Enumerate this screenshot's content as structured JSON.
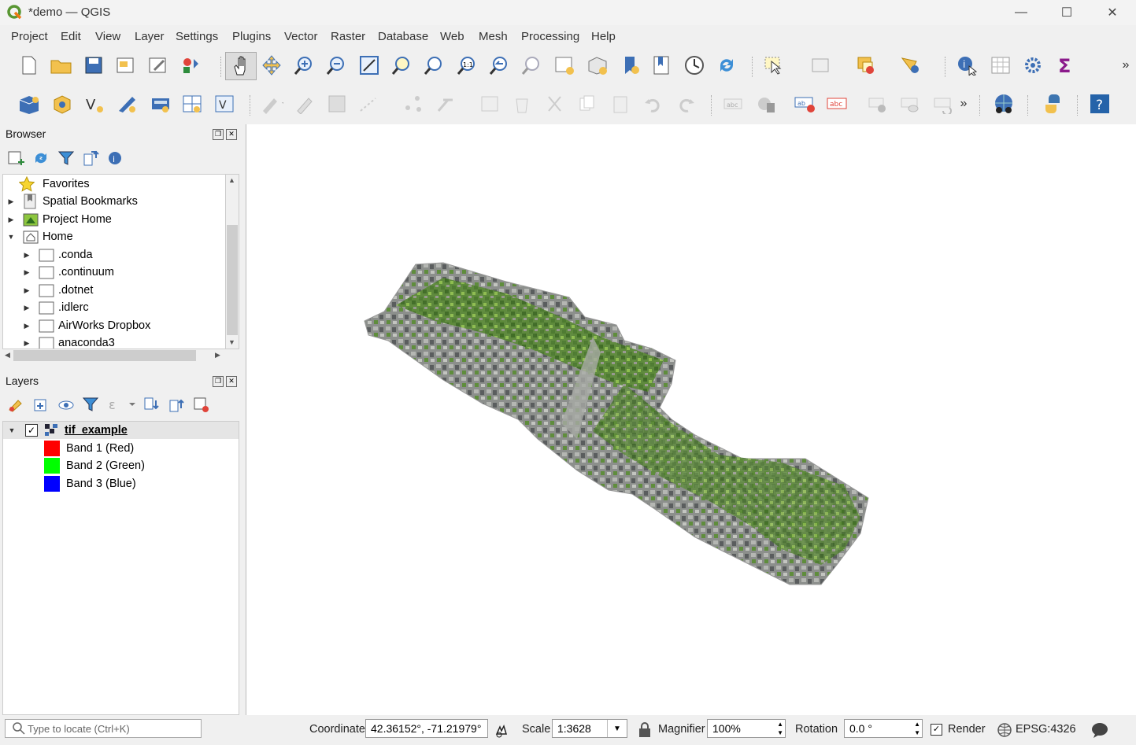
{
  "window": {
    "title": "*demo — QGIS"
  },
  "menu": [
    "Project",
    "Edit",
    "View",
    "Layer",
    "Settings",
    "Plugins",
    "Vector",
    "Raster",
    "Database",
    "Web",
    "Mesh",
    "Processing",
    "Help"
  ],
  "browser": {
    "title": "Browser",
    "items": [
      {
        "label": "Favorites",
        "icon": "star-icon"
      },
      {
        "label": "Spatial Bookmarks",
        "icon": "bookmark-icon"
      },
      {
        "label": "Project Home",
        "icon": "project-home-icon"
      },
      {
        "label": "Home",
        "icon": "home-icon"
      },
      {
        "label": ".conda",
        "icon": "folder-icon"
      },
      {
        "label": ".continuum",
        "icon": "folder-icon"
      },
      {
        "label": ".dotnet",
        "icon": "folder-icon"
      },
      {
        "label": ".idlerc",
        "icon": "folder-icon"
      },
      {
        "label": "AirWorks Dropbox",
        "icon": "folder-icon"
      },
      {
        "label": "anaconda3",
        "icon": "folder-icon"
      }
    ]
  },
  "layers": {
    "title": "Layers",
    "layer_name": "tif_example",
    "bands": [
      {
        "label": "Band 1 (Red)",
        "color": "#ff0000"
      },
      {
        "label": "Band 2 (Green)",
        "color": "#00ff00"
      },
      {
        "label": "Band 3 (Blue)",
        "color": "#0000ff"
      }
    ]
  },
  "status": {
    "locate_placeholder": "Type to locate (Ctrl+K)",
    "coordinate_label": "Coordinate",
    "coordinate_value": "42.36152°, -71.21979°",
    "scale_label": "Scale",
    "scale_value": "1:3628",
    "magnifier_label": "Magnifier",
    "magnifier_value": "100%",
    "rotation_label": "Rotation",
    "rotation_value": "0.0 °",
    "render_label": "Render",
    "crs": "EPSG:4326"
  }
}
